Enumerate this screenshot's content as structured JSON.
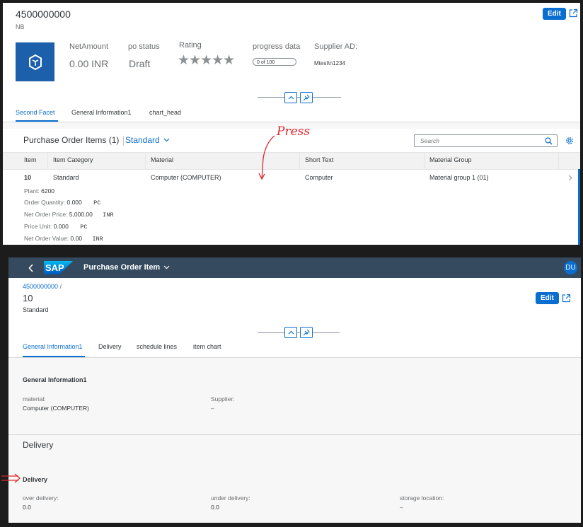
{
  "top_page": {
    "title": "4500000000",
    "subtitle": "NB",
    "edit_label": "Edit",
    "kpis": [
      {
        "label": "NetAmount",
        "value": "0.00  INR"
      },
      {
        "label": "po status",
        "value": "Draft"
      },
      {
        "label": "Rating",
        "value": "★★★★★"
      },
      {
        "label": "progress data",
        "value": "0 of 100"
      },
      {
        "label": "Supplier AD:",
        "value": "Mtest\\n1234"
      }
    ],
    "tabs": [
      "Second Facet",
      "General Information1",
      "chart_head"
    ],
    "table_title": "Purchase Order Items (1)",
    "variant": "Standard",
    "search_placeholder": "Search",
    "columns": [
      "Item",
      "Item Category",
      "Material",
      "Short Text",
      "Material Group"
    ],
    "row": {
      "item": "10",
      "category": "Standard",
      "material": "Computer (COMPUTER)",
      "short_text": "Computer",
      "material_group": "Material group 1 (01)"
    },
    "details": [
      {
        "label": "Plant:",
        "value": "6200",
        "unit": ""
      },
      {
        "label": "Order Quantity:",
        "value": "0.000",
        "unit": "PC"
      },
      {
        "label": "Net Order Price:",
        "value": "5,000.00",
        "unit": "INR"
      },
      {
        "label": "Price Unit:",
        "value": "0.000",
        "unit": "PC"
      },
      {
        "label": "Net Order Value:",
        "value": "0.00",
        "unit": "INR"
      }
    ],
    "annotation": "Press"
  },
  "bottom_page": {
    "shell_title": "Purchase Order Item",
    "avatar": "DU",
    "breadcrumb": "4500000000",
    "breadcrumb_sep": "/",
    "title": "10",
    "subtitle": "Standard",
    "edit_label": "Edit",
    "tabs": [
      "General Information1",
      "Delivery",
      "schedule lines",
      "item chart"
    ],
    "gi_section_title": "General Information1",
    "gi_fields": [
      {
        "label": "material:",
        "value": "Computer (COMPUTER)"
      },
      {
        "label": "Supplier:",
        "value": "–"
      }
    ],
    "delivery_section": "Delivery",
    "delivery_group": "Delivery",
    "delivery_fields": [
      {
        "label": "over delivery:",
        "value": "0.0"
      },
      {
        "label": "under delivery:",
        "value": "0.0"
      },
      {
        "label": "storage location:",
        "value": "–"
      }
    ]
  }
}
